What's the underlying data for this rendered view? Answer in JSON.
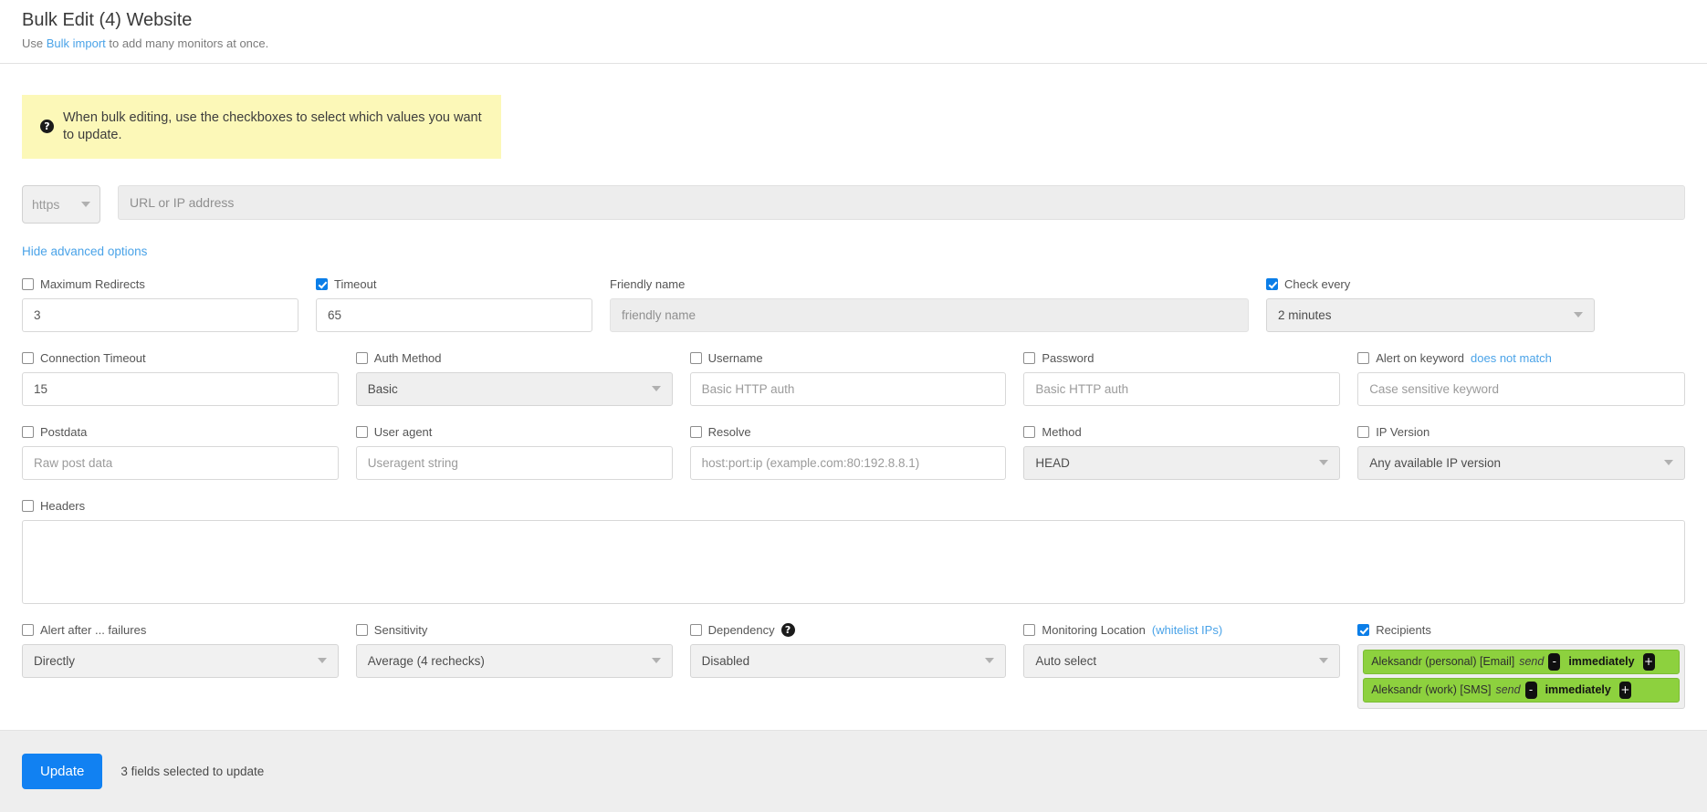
{
  "header": {
    "title": "Bulk Edit (4) Website",
    "sub_prefix": "Use ",
    "sub_link": "Bulk import",
    "sub_suffix": " to add many monitors at once."
  },
  "notice": {
    "icon": "question-circle-icon",
    "text": "When bulk editing, use the checkboxes to select which values you want to update."
  },
  "url_row": {
    "protocol": "https",
    "url_placeholder": "URL or IP address"
  },
  "advanced_toggle": "Hide advanced options",
  "fields": {
    "maximum_redirects": {
      "label": "Maximum Redirects",
      "checked": false,
      "value": "3"
    },
    "timeout": {
      "label": "Timeout",
      "checked": true,
      "value": "65"
    },
    "friendly_name": {
      "label": "Friendly name",
      "placeholder": "friendly name"
    },
    "check_every": {
      "label": "Check every",
      "checked": true,
      "value": "2 minutes"
    },
    "connection_timeout": {
      "label": "Connection Timeout",
      "checked": false,
      "value": "15"
    },
    "auth_method": {
      "label": "Auth Method",
      "checked": false,
      "value": "Basic"
    },
    "username": {
      "label": "Username",
      "checked": false,
      "placeholder": "Basic HTTP auth"
    },
    "password": {
      "label": "Password",
      "checked": false,
      "placeholder": "Basic HTTP auth"
    },
    "alert_on_keyword": {
      "label": "Alert on keyword",
      "link": "does not match",
      "checked": false,
      "placeholder": "Case sensitive keyword"
    },
    "postdata": {
      "label": "Postdata",
      "checked": false,
      "placeholder": "Raw post data"
    },
    "user_agent": {
      "label": "User agent",
      "checked": false,
      "placeholder": "Useragent string"
    },
    "resolve": {
      "label": "Resolve",
      "checked": false,
      "placeholder": "host:port:ip (example.com:80:192.8.8.1)"
    },
    "method": {
      "label": "Method",
      "checked": false,
      "value": "HEAD"
    },
    "ip_version": {
      "label": "IP Version",
      "checked": false,
      "value": "Any available IP version"
    },
    "headers": {
      "label": "Headers",
      "checked": false,
      "value": ""
    },
    "alert_after_failures": {
      "label": "Alert after ... failures",
      "checked": false,
      "value": "Directly"
    },
    "sensitivity": {
      "label": "Sensitivity",
      "checked": false,
      "value": "Average (4 rechecks)"
    },
    "dependency": {
      "label": "Dependency",
      "checked": false,
      "value": "Disabled",
      "help_icon": "question-circle-icon"
    },
    "monitoring_location": {
      "label": "Monitoring Location",
      "link": "(whitelist IPs)",
      "checked": false,
      "value": "Auto select"
    },
    "recipients": {
      "label": "Recipients",
      "checked": true,
      "tags": [
        {
          "name": "Aleksandr (personal) [Email]",
          "send": "send",
          "minus": "-",
          "timing": "immediately",
          "plus": "+"
        },
        {
          "name": "Aleksandr (work) [SMS]",
          "send": "send",
          "minus": "-",
          "timing": "immediately",
          "plus": "+"
        }
      ]
    }
  },
  "footer": {
    "update_label": "Update",
    "note": "3 fields selected to update"
  },
  "colors": {
    "accent": "#1181f2",
    "checkbox": "#0b7ee8",
    "notice_bg": "#fcf8b8",
    "tag_green": "#8dd13e",
    "link": "#4aa3e8"
  }
}
